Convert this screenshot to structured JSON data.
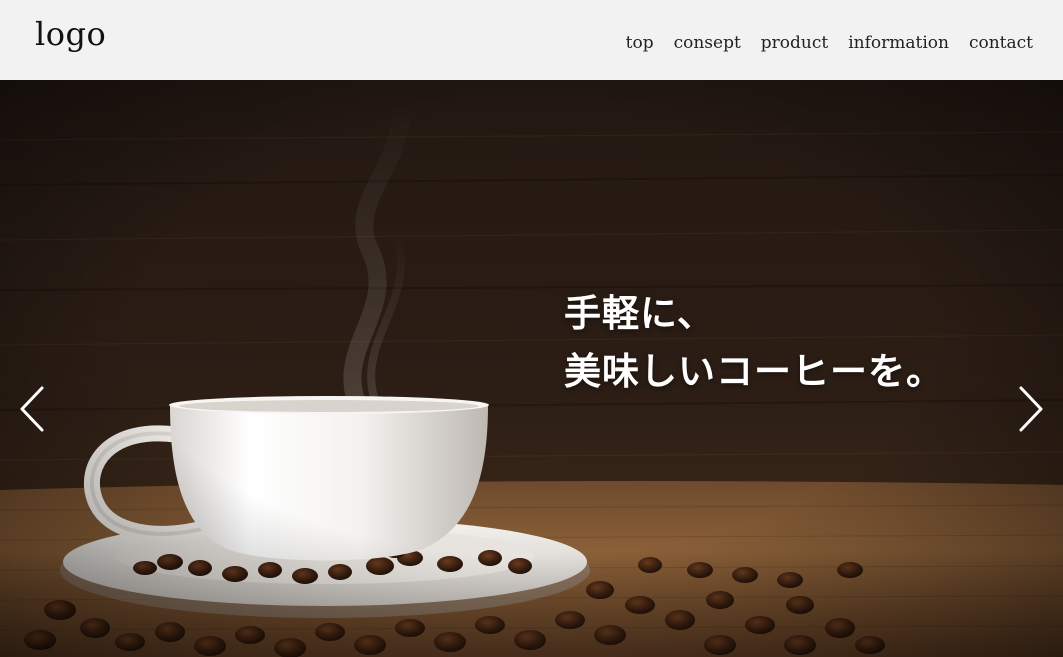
{
  "header": {
    "logo": "logo",
    "nav": [
      {
        "label": "top"
      },
      {
        "label": "consept"
      },
      {
        "label": "product"
      },
      {
        "label": "information"
      },
      {
        "label": "contact"
      }
    ]
  },
  "hero": {
    "image": "coffee-cup-and-beans-photo",
    "catch_line_1": "手軽に、",
    "catch_line_2": "美味しいコーヒーを。",
    "prev_icon": "chevron-left-icon",
    "next_icon": "chevron-right-icon"
  },
  "colors": {
    "header_bg": "#f2f2f2",
    "text_dark": "#111111",
    "text_light": "#ffffff"
  }
}
